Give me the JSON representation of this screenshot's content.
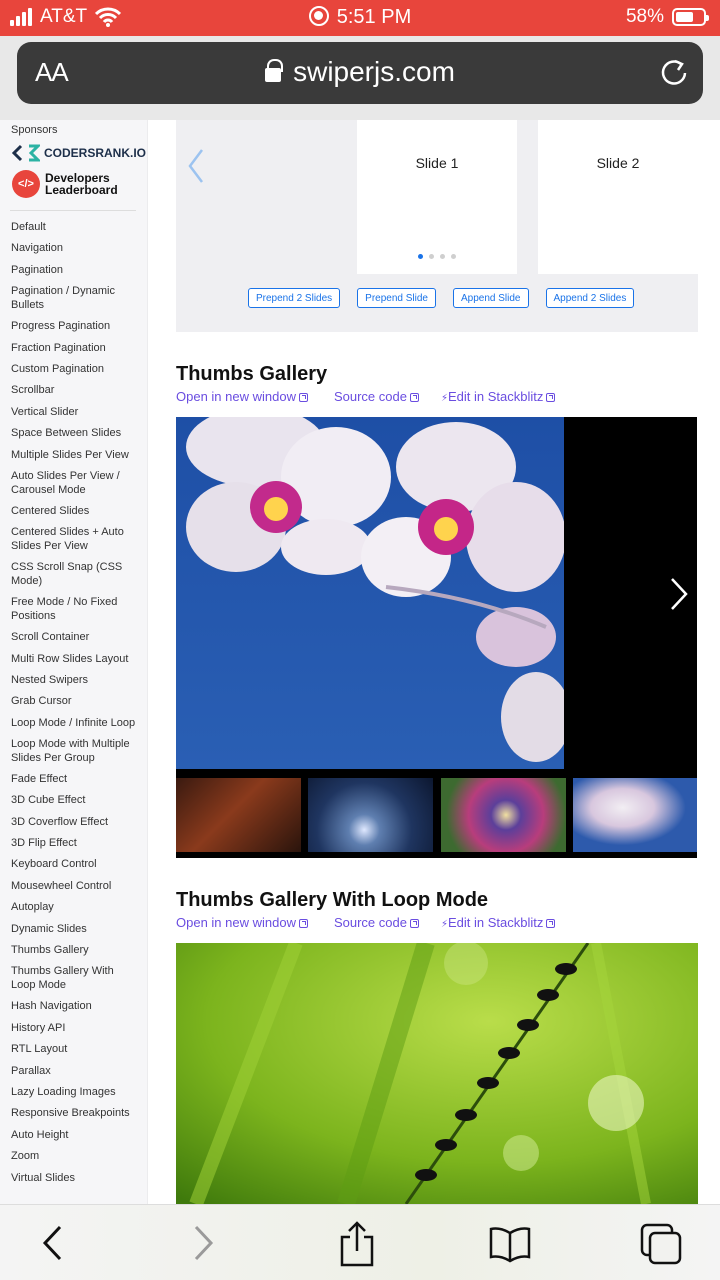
{
  "status_bar": {
    "carrier": "AT&T",
    "time": "5:51 PM",
    "battery": "58%"
  },
  "browser": {
    "aa_label": "AA",
    "url": "swiperjs.com"
  },
  "sidebar": {
    "sponsors_label": "Sponsors",
    "sponsor_1": "CODERSRANK.IO",
    "sponsor_2_line1": "Developers",
    "sponsor_2_line2": "Leaderboard",
    "items": [
      "Default",
      "Navigation",
      "Pagination",
      "Pagination / Dynamic Bullets",
      "Progress Pagination",
      "Fraction Pagination",
      "Custom Pagination",
      "Scrollbar",
      "Vertical Slider",
      "Space Between Slides",
      "Multiple Slides Per View",
      "Auto Slides Per View / Carousel Mode",
      "Centered Slides",
      "Centered Slides + Auto Slides Per View",
      "CSS Scroll Snap (CSS Mode)",
      "Free Mode / No Fixed Positions",
      "Scroll Container",
      "Multi Row Slides Layout",
      "Nested Swipers",
      "Grab Cursor",
      "Loop Mode / Infinite Loop",
      "Loop Mode with Multiple Slides Per Group",
      "Fade Effect",
      "3D Cube Effect",
      "3D Coverflow Effect",
      "3D Flip Effect",
      "Keyboard Control",
      "Mousewheel Control",
      "Autoplay",
      "Dynamic Slides",
      "Thumbs Gallery",
      "Thumbs Gallery With Loop Mode",
      "Hash Navigation",
      "History API",
      "RTL Layout",
      "Parallax",
      "Lazy Loading Images",
      "Responsive Breakpoints",
      "Auto Height",
      "Zoom",
      "Virtual Slides"
    ]
  },
  "demo": {
    "slide_1": "Slide 1",
    "slide_2": "Slide 2",
    "buttons": [
      "Prepend 2 Slides",
      "Prepend Slide",
      "Append Slide",
      "Append 2 Slides"
    ]
  },
  "thumbs_gallery": {
    "title": "Thumbs Gallery",
    "open_link": "Open in new window",
    "source_link": "Source code",
    "stackblitz_link": "Edit in Stackblitz"
  },
  "thumbs_loop": {
    "title": "Thumbs Gallery With Loop Mode",
    "open_link": "Open in new window",
    "source_link": "Source code",
    "stackblitz_link": "Edit in Stackblitz"
  },
  "colors": {
    "status_bar": "#e8453c",
    "link": "#6a4de0",
    "accent": "#1a73e8"
  }
}
